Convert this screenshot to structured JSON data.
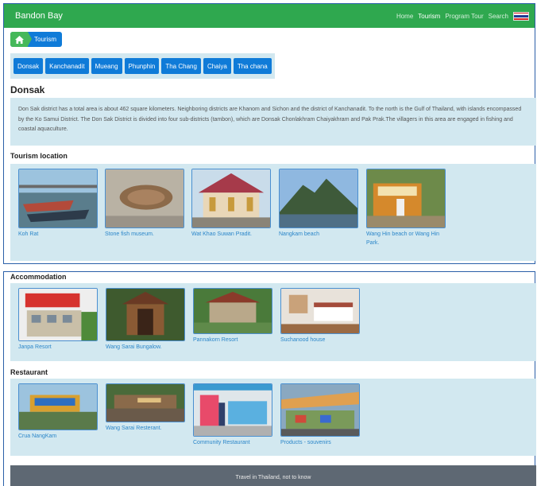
{
  "navbar": {
    "brand": "Bandon Bay",
    "menu": [
      {
        "label": "Home",
        "active": false
      },
      {
        "label": "Tourism",
        "active": true
      },
      {
        "label": "Program Tour",
        "active": false
      },
      {
        "label": "Search",
        "active": false
      }
    ],
    "flag_colors": [
      "#d62828",
      "#ffffff",
      "#1f3a93",
      "#ffffff",
      "#d62828"
    ]
  },
  "breadcrumb": {
    "home_icon": "home-icon",
    "label": "Tourism"
  },
  "districts": [
    "Donsak",
    "Kanchanadit",
    "Mueang",
    "Phunphin",
    "Tha Chang",
    "Chaiya",
    "Tha chana"
  ],
  "district": {
    "title": "Donsak",
    "description": "Don Sak district has a total area is about 462 square kilometers. Neighboring districts are Khanom and Sichon and the district of Kanchanadit. To the north is the Gulf of Thailand, with islands encompassed by the Ko Samui District. The Don Sak District is divided into four sub-districts (tambon), which are Donsak Chonlakhram Chaiyakhram and Pak Prak.The villagers in this area are engaged in fishing and coastal aquaculture."
  },
  "tourism": {
    "title": "Tourism location",
    "items": [
      "Koh Rat",
      "Stone fish museum.",
      "Wat Khao Suwan Pradit.",
      "Nangkam beach",
      "Wang Hin beach or Wang Hin Park."
    ]
  },
  "accommodation": {
    "title": "Accommodation",
    "items": [
      "Janpa Resort",
      "Wang Sarai Bungalow.",
      "Pannakorn Resort",
      "Suchanood house"
    ]
  },
  "restaurant": {
    "title": "Restaurant",
    "items": [
      "Crua NangKam",
      "Wang Sarai Resterant.",
      "Community Restaurant",
      "Products - souvenirs"
    ]
  },
  "footer": {
    "text": "Travel in Thailand, not to know"
  }
}
